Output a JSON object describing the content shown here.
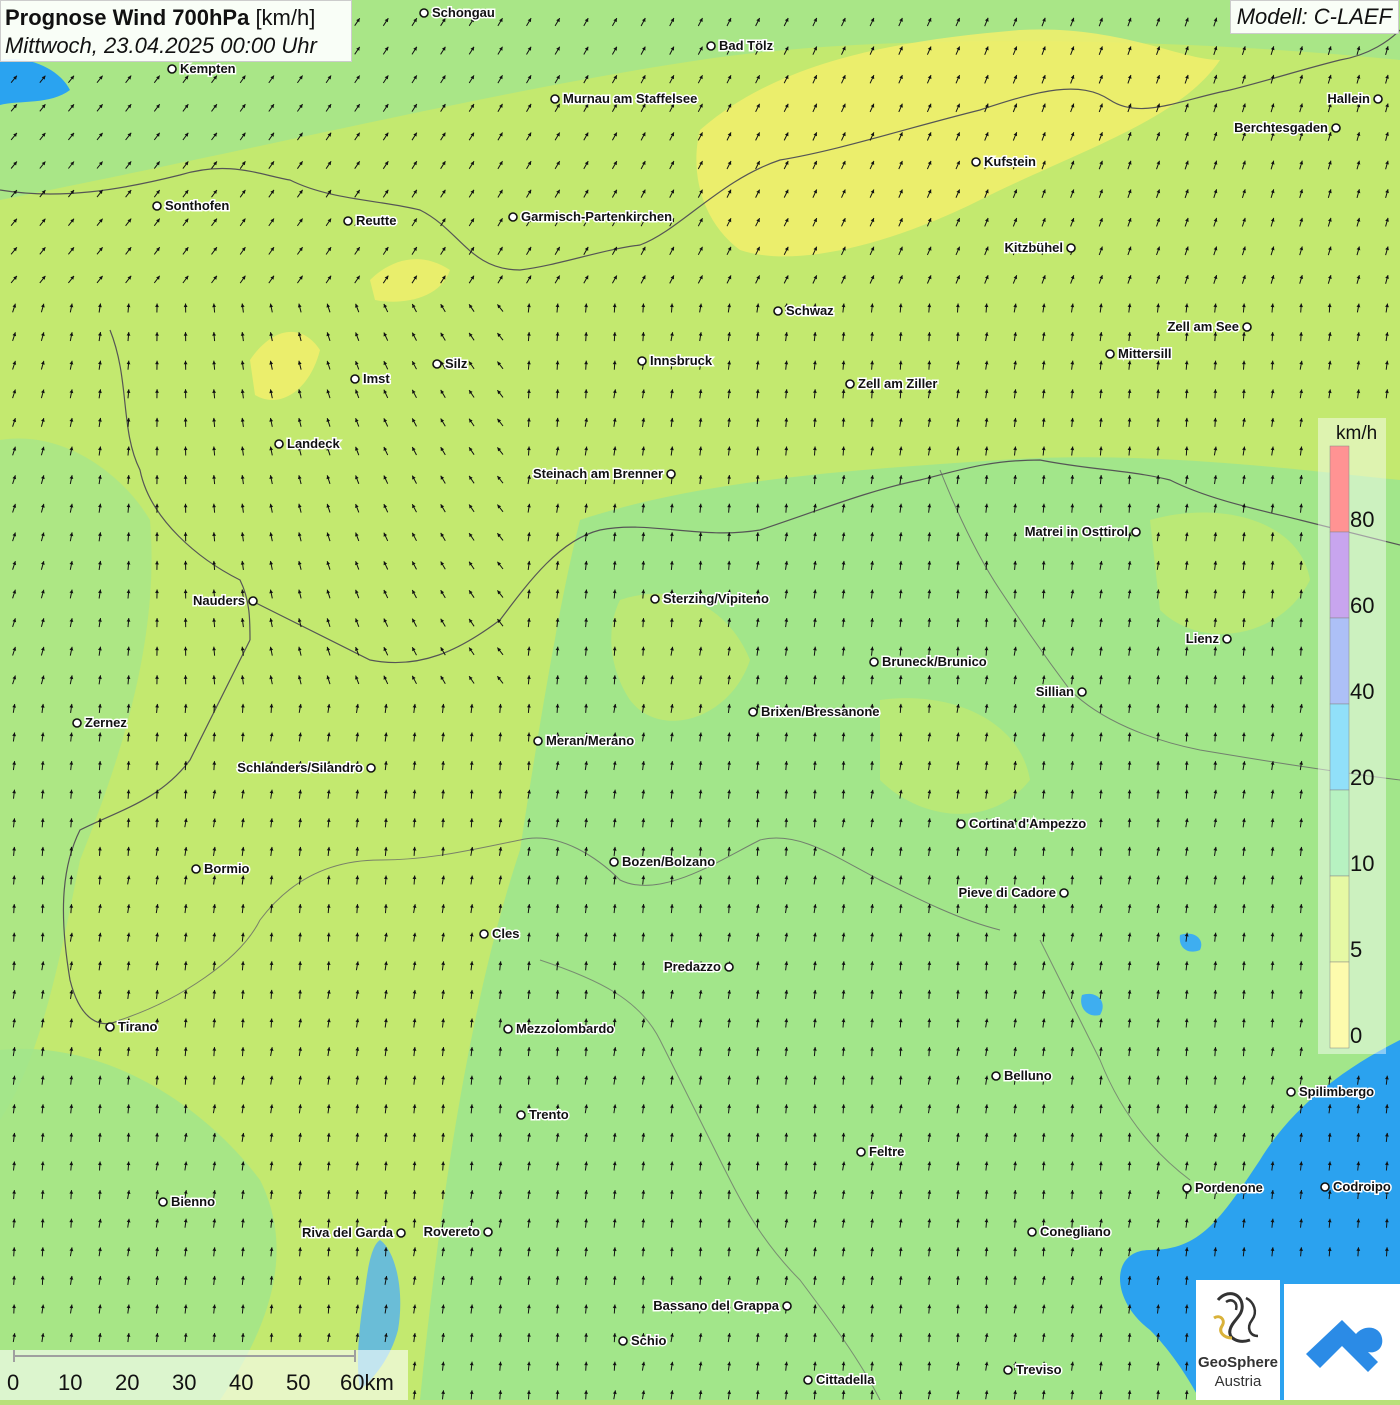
{
  "title": {
    "main": "Prognose Wind 700hPa",
    "unit": "[km/h]",
    "datetime": "Mittwoch, 23.04.2025 00:00 Uhr"
  },
  "model": "Modell: C-LAEF",
  "legend": {
    "unit": "km/h",
    "ticks": [
      "80",
      "60",
      "40",
      "20",
      "10",
      "5",
      "0"
    ],
    "colors": [
      "#ff3b3b",
      "#9b5be0",
      "#6a8df0",
      "#38c6f4",
      "#7de88f",
      "#d2f55a",
      "#fbf76a"
    ]
  },
  "colors": {
    "calm_yellow": "#f5f06a",
    "light_green": "#cbef6a",
    "mid_green": "#9ee68a",
    "water_blue": "#2aa3f0",
    "lake_blue": "#5ab4e8",
    "border": "#555555"
  },
  "cities": [
    "Schongau",
    "Kempten",
    "Bad Tölz",
    "Murnau am Staffelsee",
    "Hallein",
    "Berchtesgaden",
    "Kufstein",
    "Sonthofen",
    "Reutte",
    "Garmisch-Partenkirchen",
    "Kitzbühel",
    "Schwaz",
    "Zell am See",
    "Mittersill",
    "Innsbruck",
    "Imst",
    "Silz",
    "Zell am Ziller",
    "Landeck",
    "Steinach am Brenner",
    "Matrei in Osttirol",
    "Nauders",
    "Sterzing/Vipiteno",
    "Lienz",
    "Bruneck/Brunico",
    "Sillian",
    "Zernez",
    "Brixen/Bressanone",
    "Meran/Merano",
    "Schlanders/Silandro",
    "Cortina d'Ampezzo",
    "Bormio",
    "Bozen/Bolzano",
    "Pieve di Cadore",
    "Cles",
    "Predazzo",
    "Tirano",
    "Mezzolombardo",
    "Belluno",
    "Spilimbergo",
    "Trento",
    "Feltre",
    "Pordenone",
    "Codroipo",
    "Bienno",
    "Riva del Garda",
    "Rovereto",
    "Conegliano",
    "Bassano del Grappa",
    "Schio",
    "Treviso",
    "Cittadella"
  ],
  "scale": {
    "ticks": [
      "0",
      "10",
      "20",
      "30",
      "40",
      "50",
      "60km"
    ]
  },
  "logo": {
    "line1": "GeoSphere",
    "line2": "Austria"
  }
}
